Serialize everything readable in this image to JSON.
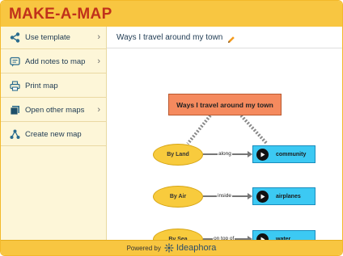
{
  "app": {
    "title": "MAKE-A-MAP"
  },
  "sidebar": {
    "items": [
      {
        "label": "Use template",
        "icon": "share-tree-icon",
        "has_submenu": true
      },
      {
        "label": "Add notes to map",
        "icon": "note-icon",
        "has_submenu": true
      },
      {
        "label": "Print map",
        "icon": "printer-icon",
        "has_submenu": false
      },
      {
        "label": "Open other maps",
        "icon": "folder-icon",
        "has_submenu": true
      },
      {
        "label": "Create new map",
        "icon": "new-map-icon",
        "has_submenu": false
      }
    ]
  },
  "map": {
    "title": "Ways I travel around my town",
    "central_node": "Ways I travel around my town",
    "branches": [
      {
        "mode": "By Land",
        "link": "along",
        "target": "community"
      },
      {
        "mode": "By Air",
        "link": "inside",
        "target": "airplanes"
      },
      {
        "mode": "By Sea",
        "link": "on top of",
        "target": "water"
      }
    ]
  },
  "footer": {
    "powered": "Powered by",
    "brand": "Ideaphora"
  },
  "colors": {
    "header": "#f8c641",
    "title_red": "#c0311b",
    "sidebar_bg": "#fdf6d8",
    "central_node": "#f58a5e",
    "oval_node": "#f8cb3d",
    "target_node": "#3cc9f3"
  }
}
